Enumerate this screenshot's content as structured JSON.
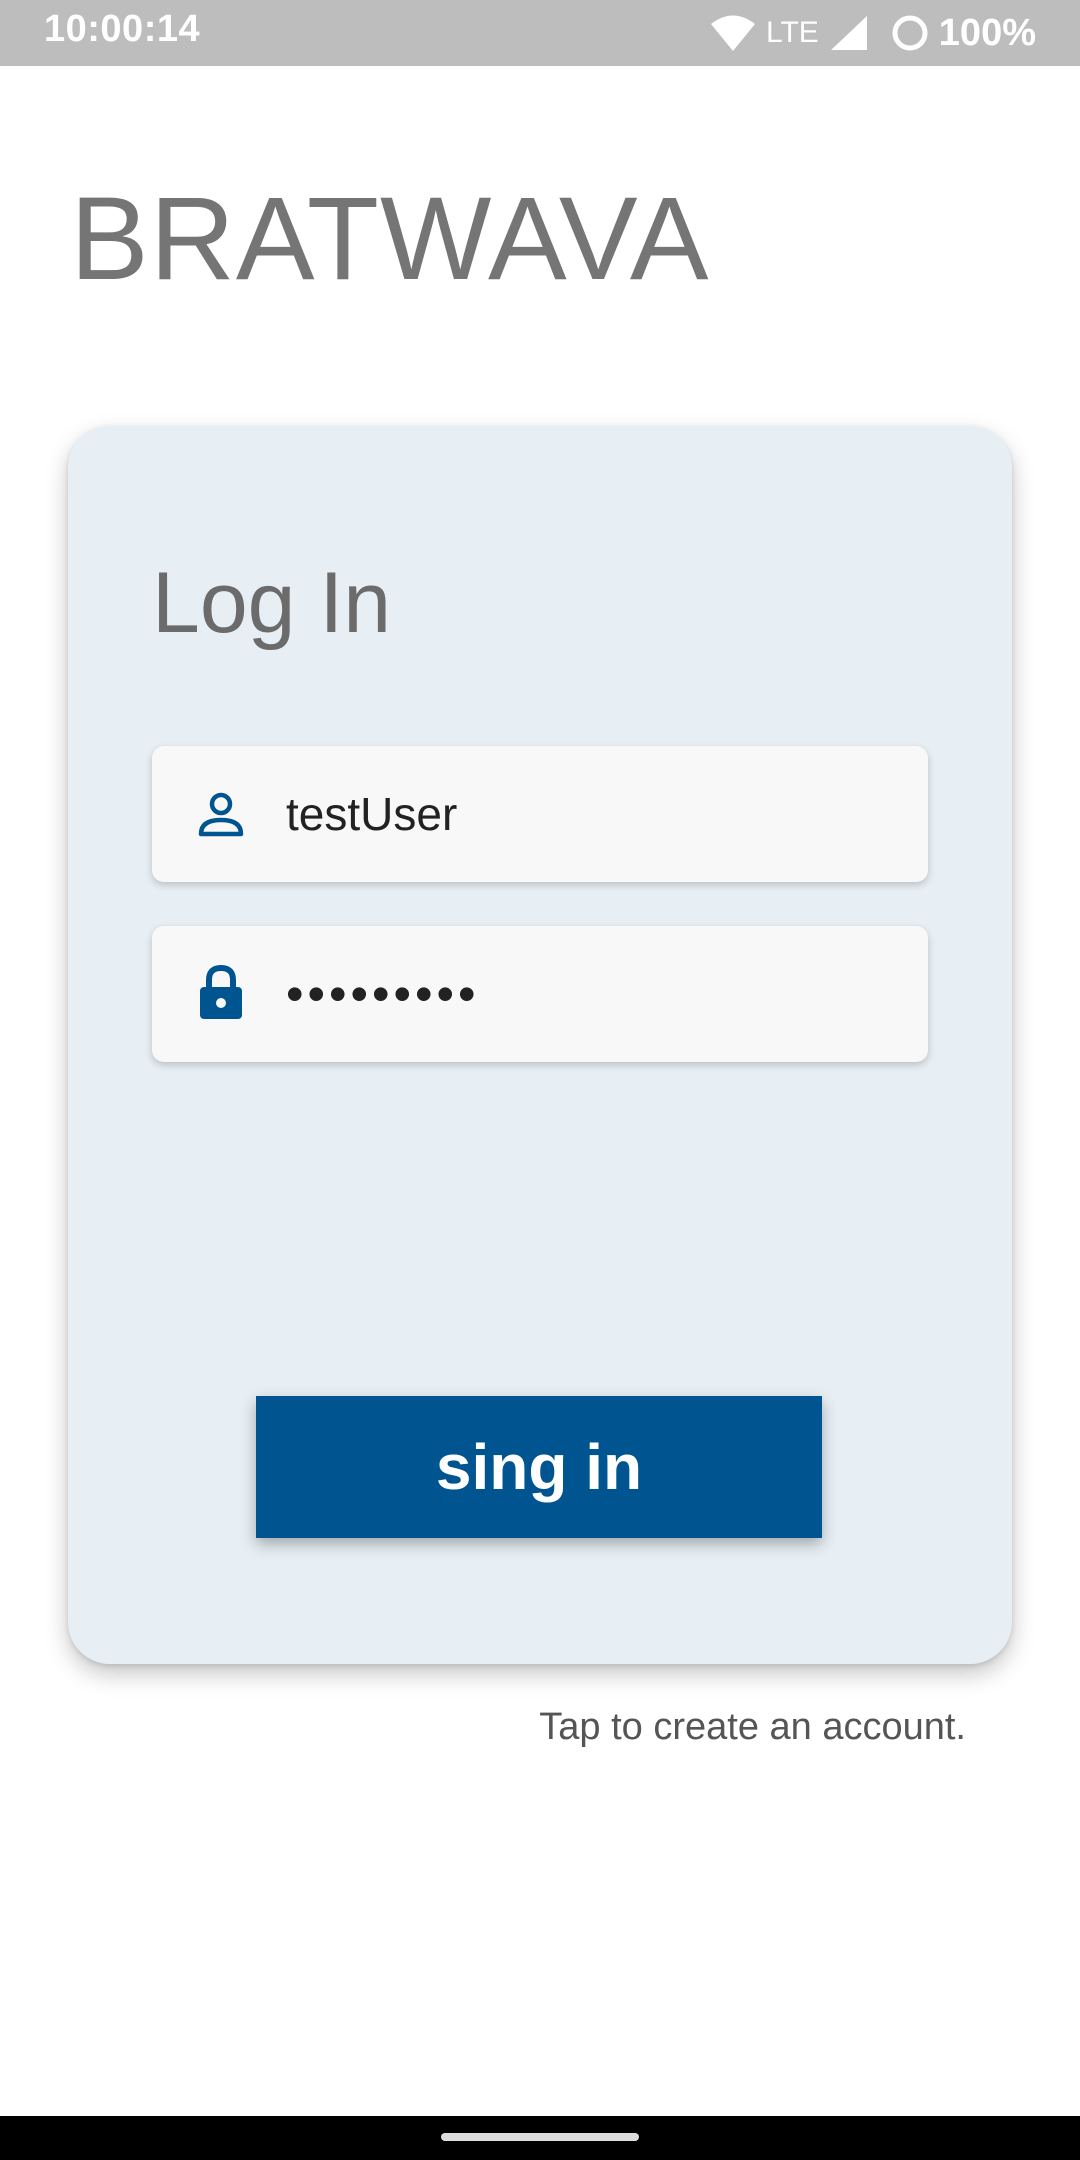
{
  "status_bar": {
    "time": "10:00:14",
    "network": "LTE",
    "battery": "100%",
    "icons": [
      "wifi-icon",
      "signal-icon",
      "battery-icon"
    ]
  },
  "app": {
    "title": "BRATWAVA"
  },
  "login_card": {
    "title": "Log In",
    "username": {
      "icon": "person-icon",
      "value": "testUser"
    },
    "password": {
      "icon": "lock-icon",
      "value": "•••••••••"
    },
    "signin_label": "sing in"
  },
  "create_account_text": "Tap to create an account.",
  "colors": {
    "accent": "#005590",
    "card_background": "#e7eff5",
    "status_bar": "#bdbdbd",
    "title_text": "#757575"
  }
}
